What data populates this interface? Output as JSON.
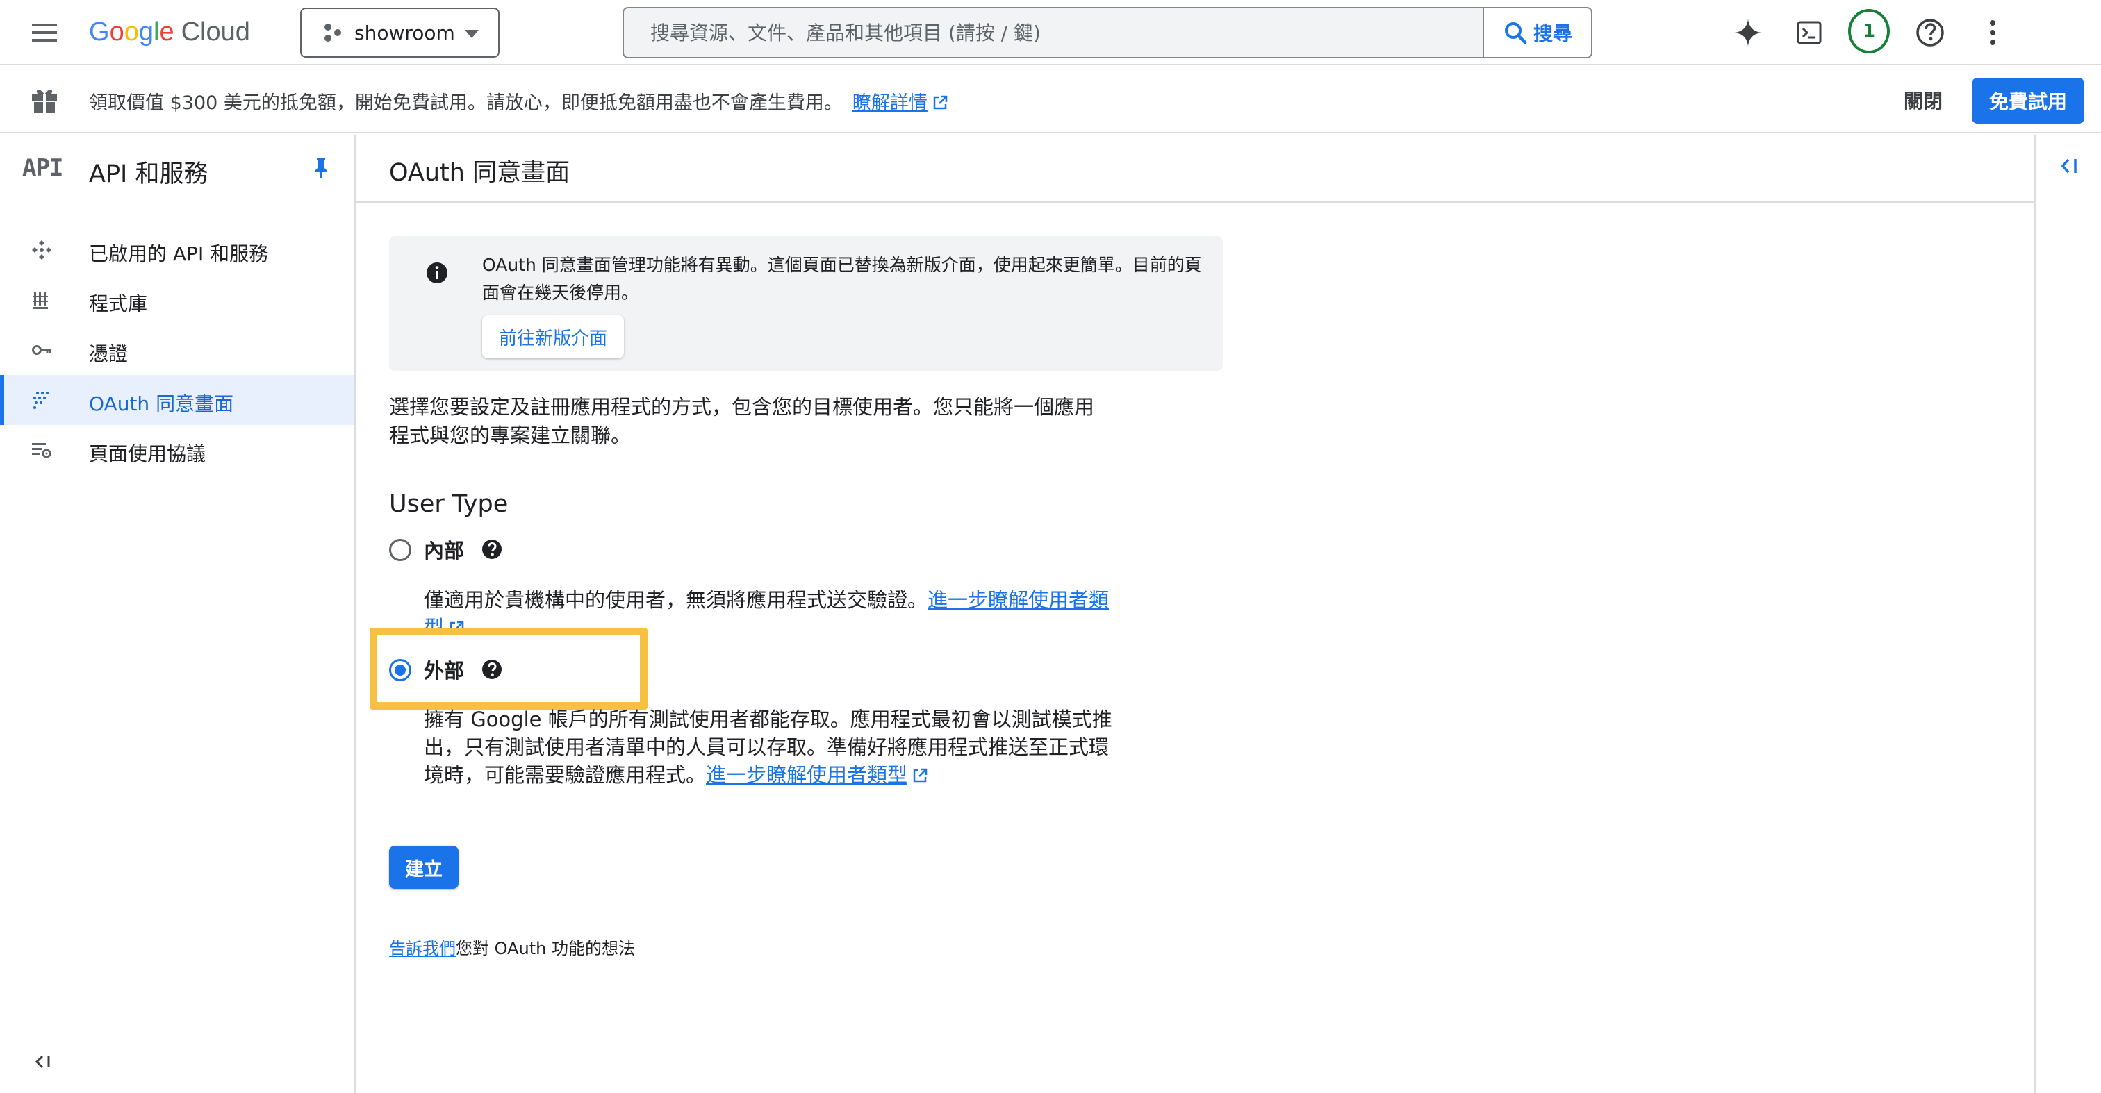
{
  "topbar": {
    "logo_google": "Google",
    "logo_cloud": "Cloud",
    "project": "showroom",
    "search_placeholder": "搜尋資源、文件、產品和其他項目 (請按 / 鍵)",
    "search_button": "搜尋",
    "notifications_count": "1"
  },
  "promo": {
    "message": "領取價值 $300 美元的抵免額，開始免費試用。請放心，即便抵免額用盡也不會產生費用。",
    "learn_more": "瞭解詳情",
    "dismiss": "關閉",
    "free_trial": "免費試用"
  },
  "sidebar": {
    "api_logo": "API",
    "title": "API 和服務",
    "items": [
      {
        "label": "已啟用的 API 和服務",
        "icon": "api-hub-icon"
      },
      {
        "label": "程式庫",
        "icon": "library-icon"
      },
      {
        "label": "憑證",
        "icon": "key-icon"
      },
      {
        "label": "OAuth 同意畫面",
        "icon": "oauth-dots-icon",
        "active": true
      },
      {
        "label": "頁面使用協議",
        "icon": "settings-list-icon"
      }
    ]
  },
  "main": {
    "page_title": "OAuth 同意畫面",
    "notice": {
      "text": "OAuth 同意畫面管理功能將有異動。這個頁面已替換為新版介面，使用起來更簡單。目前的頁面會在幾天後停用。",
      "button": "前往新版介面"
    },
    "description": "選擇您要設定及註冊應用程式的方式，包含您的目標使用者。您只能將一個應用程式與您的專案建立關聯。",
    "user_type_heading": "User Type",
    "options": [
      {
        "label": "內部",
        "selected": false,
        "description": "僅適用於貴機構中的使用者，無須將應用程式送交驗證。",
        "link": "進一步瞭解使用者類型"
      },
      {
        "label": "外部",
        "selected": true,
        "description": "擁有 Google 帳戶的所有測試使用者都能存取。應用程式最初會以測試模式推出，只有測試使用者清單中的人員可以存取。準備好將應用程式推送至正式環境時，可能需要驗證應用程式。",
        "link": "進一步瞭解使用者類型"
      }
    ],
    "create_button": "建立",
    "feedback_link": "告訴我們",
    "feedback_text": "您對 OAuth 功能的想法"
  },
  "colors": {
    "accent": "#1a73e8",
    "highlight": "#f6c142",
    "active_nav_bg": "#e8f0fe"
  }
}
